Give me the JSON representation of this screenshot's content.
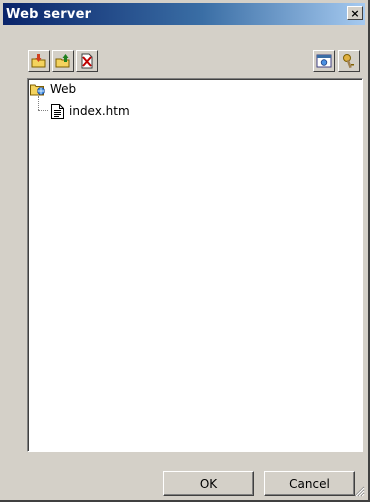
{
  "window": {
    "title": "Web server",
    "close_glyph": "×"
  },
  "toolbar": {
    "left_buttons": [
      {
        "icon": "import-folder-icon"
      },
      {
        "icon": "export-folder-icon"
      },
      {
        "icon": "delete-file-icon"
      }
    ],
    "right_buttons": [
      {
        "icon": "browser-preview-icon"
      },
      {
        "icon": "properties-icon"
      }
    ]
  },
  "tree": {
    "root": {
      "label": "Web",
      "icon": "web-folder-icon"
    },
    "children": [
      {
        "label": "index.htm",
        "icon": "document-icon"
      }
    ]
  },
  "buttons": {
    "ok_label": "OK",
    "cancel_label": "Cancel"
  }
}
